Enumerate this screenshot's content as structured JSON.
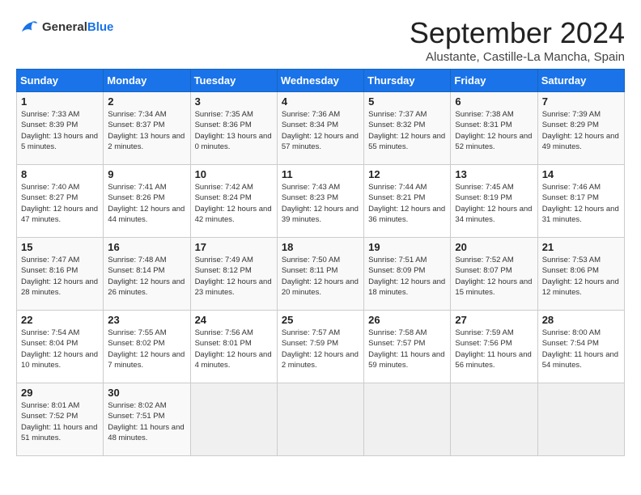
{
  "header": {
    "logo_general": "General",
    "logo_blue": "Blue",
    "month_title": "September 2024",
    "subtitle": "Alustante, Castille-La Mancha, Spain"
  },
  "weekdays": [
    "Sunday",
    "Monday",
    "Tuesday",
    "Wednesday",
    "Thursday",
    "Friday",
    "Saturday"
  ],
  "weeks": [
    [
      {
        "day": "1",
        "sunrise": "7:33 AM",
        "sunset": "8:39 PM",
        "daylight": "13 hours and 5 minutes."
      },
      {
        "day": "2",
        "sunrise": "7:34 AM",
        "sunset": "8:37 PM",
        "daylight": "13 hours and 2 minutes."
      },
      {
        "day": "3",
        "sunrise": "7:35 AM",
        "sunset": "8:36 PM",
        "daylight": "13 hours and 0 minutes."
      },
      {
        "day": "4",
        "sunrise": "7:36 AM",
        "sunset": "8:34 PM",
        "daylight": "12 hours and 57 minutes."
      },
      {
        "day": "5",
        "sunrise": "7:37 AM",
        "sunset": "8:32 PM",
        "daylight": "12 hours and 55 minutes."
      },
      {
        "day": "6",
        "sunrise": "7:38 AM",
        "sunset": "8:31 PM",
        "daylight": "12 hours and 52 minutes."
      },
      {
        "day": "7",
        "sunrise": "7:39 AM",
        "sunset": "8:29 PM",
        "daylight": "12 hours and 49 minutes."
      }
    ],
    [
      {
        "day": "8",
        "sunrise": "7:40 AM",
        "sunset": "8:27 PM",
        "daylight": "12 hours and 47 minutes."
      },
      {
        "day": "9",
        "sunrise": "7:41 AM",
        "sunset": "8:26 PM",
        "daylight": "12 hours and 44 minutes."
      },
      {
        "day": "10",
        "sunrise": "7:42 AM",
        "sunset": "8:24 PM",
        "daylight": "12 hours and 42 minutes."
      },
      {
        "day": "11",
        "sunrise": "7:43 AM",
        "sunset": "8:23 PM",
        "daylight": "12 hours and 39 minutes."
      },
      {
        "day": "12",
        "sunrise": "7:44 AM",
        "sunset": "8:21 PM",
        "daylight": "12 hours and 36 minutes."
      },
      {
        "day": "13",
        "sunrise": "7:45 AM",
        "sunset": "8:19 PM",
        "daylight": "12 hours and 34 minutes."
      },
      {
        "day": "14",
        "sunrise": "7:46 AM",
        "sunset": "8:17 PM",
        "daylight": "12 hours and 31 minutes."
      }
    ],
    [
      {
        "day": "15",
        "sunrise": "7:47 AM",
        "sunset": "8:16 PM",
        "daylight": "12 hours and 28 minutes."
      },
      {
        "day": "16",
        "sunrise": "7:48 AM",
        "sunset": "8:14 PM",
        "daylight": "12 hours and 26 minutes."
      },
      {
        "day": "17",
        "sunrise": "7:49 AM",
        "sunset": "8:12 PM",
        "daylight": "12 hours and 23 minutes."
      },
      {
        "day": "18",
        "sunrise": "7:50 AM",
        "sunset": "8:11 PM",
        "daylight": "12 hours and 20 minutes."
      },
      {
        "day": "19",
        "sunrise": "7:51 AM",
        "sunset": "8:09 PM",
        "daylight": "12 hours and 18 minutes."
      },
      {
        "day": "20",
        "sunrise": "7:52 AM",
        "sunset": "8:07 PM",
        "daylight": "12 hours and 15 minutes."
      },
      {
        "day": "21",
        "sunrise": "7:53 AM",
        "sunset": "8:06 PM",
        "daylight": "12 hours and 12 minutes."
      }
    ],
    [
      {
        "day": "22",
        "sunrise": "7:54 AM",
        "sunset": "8:04 PM",
        "daylight": "12 hours and 10 minutes."
      },
      {
        "day": "23",
        "sunrise": "7:55 AM",
        "sunset": "8:02 PM",
        "daylight": "12 hours and 7 minutes."
      },
      {
        "day": "24",
        "sunrise": "7:56 AM",
        "sunset": "8:01 PM",
        "daylight": "12 hours and 4 minutes."
      },
      {
        "day": "25",
        "sunrise": "7:57 AM",
        "sunset": "7:59 PM",
        "daylight": "12 hours and 2 minutes."
      },
      {
        "day": "26",
        "sunrise": "7:58 AM",
        "sunset": "7:57 PM",
        "daylight": "11 hours and 59 minutes."
      },
      {
        "day": "27",
        "sunrise": "7:59 AM",
        "sunset": "7:56 PM",
        "daylight": "11 hours and 56 minutes."
      },
      {
        "day": "28",
        "sunrise": "8:00 AM",
        "sunset": "7:54 PM",
        "daylight": "11 hours and 54 minutes."
      }
    ],
    [
      {
        "day": "29",
        "sunrise": "8:01 AM",
        "sunset": "7:52 PM",
        "daylight": "11 hours and 51 minutes."
      },
      {
        "day": "30",
        "sunrise": "8:02 AM",
        "sunset": "7:51 PM",
        "daylight": "11 hours and 48 minutes."
      },
      null,
      null,
      null,
      null,
      null
    ]
  ]
}
